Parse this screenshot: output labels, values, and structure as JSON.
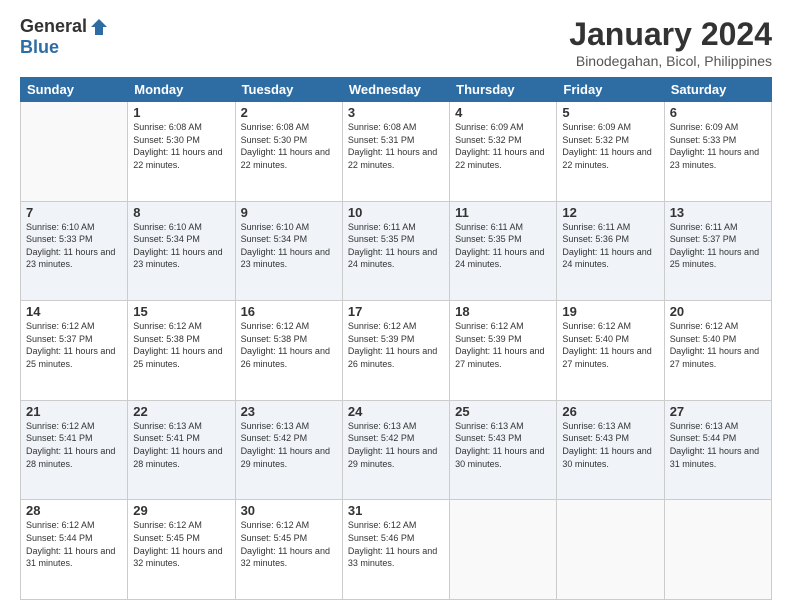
{
  "logo": {
    "general": "General",
    "blue": "Blue"
  },
  "title": "January 2024",
  "subtitle": "Binodegahan, Bicol, Philippines",
  "days_of_week": [
    "Sunday",
    "Monday",
    "Tuesday",
    "Wednesday",
    "Thursday",
    "Friday",
    "Saturday"
  ],
  "weeks": [
    [
      {
        "day": "",
        "info": ""
      },
      {
        "day": "1",
        "sunrise": "6:08 AM",
        "sunset": "5:30 PM",
        "daylight": "11 hours and 22 minutes."
      },
      {
        "day": "2",
        "sunrise": "6:08 AM",
        "sunset": "5:30 PM",
        "daylight": "11 hours and 22 minutes."
      },
      {
        "day": "3",
        "sunrise": "6:08 AM",
        "sunset": "5:31 PM",
        "daylight": "11 hours and 22 minutes."
      },
      {
        "day": "4",
        "sunrise": "6:09 AM",
        "sunset": "5:32 PM",
        "daylight": "11 hours and 22 minutes."
      },
      {
        "day": "5",
        "sunrise": "6:09 AM",
        "sunset": "5:32 PM",
        "daylight": "11 hours and 22 minutes."
      },
      {
        "day": "6",
        "sunrise": "6:09 AM",
        "sunset": "5:33 PM",
        "daylight": "11 hours and 23 minutes."
      }
    ],
    [
      {
        "day": "7",
        "sunrise": "6:10 AM",
        "sunset": "5:33 PM",
        "daylight": "11 hours and 23 minutes."
      },
      {
        "day": "8",
        "sunrise": "6:10 AM",
        "sunset": "5:34 PM",
        "daylight": "11 hours and 23 minutes."
      },
      {
        "day": "9",
        "sunrise": "6:10 AM",
        "sunset": "5:34 PM",
        "daylight": "11 hours and 23 minutes."
      },
      {
        "day": "10",
        "sunrise": "6:11 AM",
        "sunset": "5:35 PM",
        "daylight": "11 hours and 24 minutes."
      },
      {
        "day": "11",
        "sunrise": "6:11 AM",
        "sunset": "5:35 PM",
        "daylight": "11 hours and 24 minutes."
      },
      {
        "day": "12",
        "sunrise": "6:11 AM",
        "sunset": "5:36 PM",
        "daylight": "11 hours and 24 minutes."
      },
      {
        "day": "13",
        "sunrise": "6:11 AM",
        "sunset": "5:37 PM",
        "daylight": "11 hours and 25 minutes."
      }
    ],
    [
      {
        "day": "14",
        "sunrise": "6:12 AM",
        "sunset": "5:37 PM",
        "daylight": "11 hours and 25 minutes."
      },
      {
        "day": "15",
        "sunrise": "6:12 AM",
        "sunset": "5:38 PM",
        "daylight": "11 hours and 25 minutes."
      },
      {
        "day": "16",
        "sunrise": "6:12 AM",
        "sunset": "5:38 PM",
        "daylight": "11 hours and 26 minutes."
      },
      {
        "day": "17",
        "sunrise": "6:12 AM",
        "sunset": "5:39 PM",
        "daylight": "11 hours and 26 minutes."
      },
      {
        "day": "18",
        "sunrise": "6:12 AM",
        "sunset": "5:39 PM",
        "daylight": "11 hours and 27 minutes."
      },
      {
        "day": "19",
        "sunrise": "6:12 AM",
        "sunset": "5:40 PM",
        "daylight": "11 hours and 27 minutes."
      },
      {
        "day": "20",
        "sunrise": "6:12 AM",
        "sunset": "5:40 PM",
        "daylight": "11 hours and 27 minutes."
      }
    ],
    [
      {
        "day": "21",
        "sunrise": "6:12 AM",
        "sunset": "5:41 PM",
        "daylight": "11 hours and 28 minutes."
      },
      {
        "day": "22",
        "sunrise": "6:13 AM",
        "sunset": "5:41 PM",
        "daylight": "11 hours and 28 minutes."
      },
      {
        "day": "23",
        "sunrise": "6:13 AM",
        "sunset": "5:42 PM",
        "daylight": "11 hours and 29 minutes."
      },
      {
        "day": "24",
        "sunrise": "6:13 AM",
        "sunset": "5:42 PM",
        "daylight": "11 hours and 29 minutes."
      },
      {
        "day": "25",
        "sunrise": "6:13 AM",
        "sunset": "5:43 PM",
        "daylight": "11 hours and 30 minutes."
      },
      {
        "day": "26",
        "sunrise": "6:13 AM",
        "sunset": "5:43 PM",
        "daylight": "11 hours and 30 minutes."
      },
      {
        "day": "27",
        "sunrise": "6:13 AM",
        "sunset": "5:44 PM",
        "daylight": "11 hours and 31 minutes."
      }
    ],
    [
      {
        "day": "28",
        "sunrise": "6:12 AM",
        "sunset": "5:44 PM",
        "daylight": "11 hours and 31 minutes."
      },
      {
        "day": "29",
        "sunrise": "6:12 AM",
        "sunset": "5:45 PM",
        "daylight": "11 hours and 32 minutes."
      },
      {
        "day": "30",
        "sunrise": "6:12 AM",
        "sunset": "5:45 PM",
        "daylight": "11 hours and 32 minutes."
      },
      {
        "day": "31",
        "sunrise": "6:12 AM",
        "sunset": "5:46 PM",
        "daylight": "11 hours and 33 minutes."
      },
      {
        "day": "",
        "info": ""
      },
      {
        "day": "",
        "info": ""
      },
      {
        "day": "",
        "info": ""
      }
    ]
  ]
}
